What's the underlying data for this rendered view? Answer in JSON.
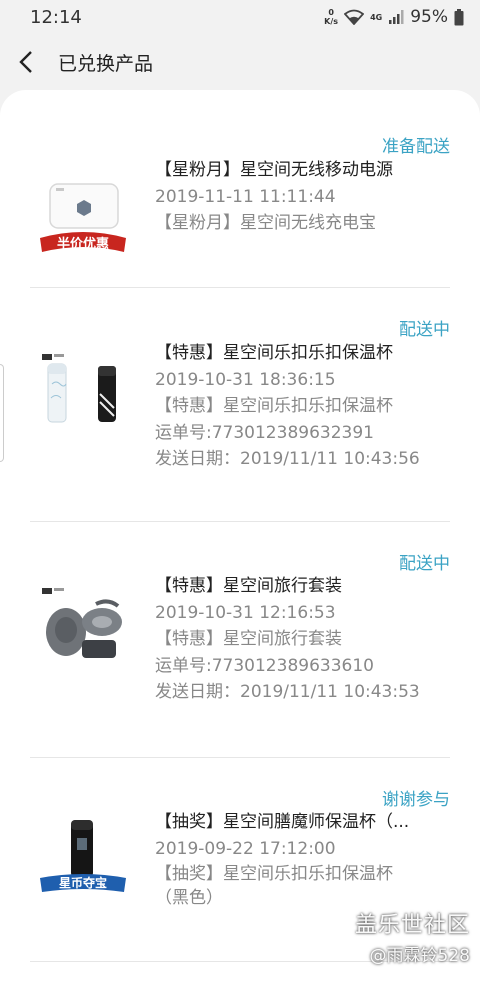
{
  "status_bar": {
    "time": "12:14",
    "net_speed_value": "0",
    "net_speed_unit": "K/s",
    "network": "4G",
    "battery": "95%"
  },
  "header": {
    "title": "已兑换产品"
  },
  "items": [
    {
      "status": "准备配送",
      "name": "【星粉月】星空间无线移动电源",
      "date": "2019-11-11 11:11:44",
      "desc": "【星粉月】星空间无线充电宝",
      "badge": "半价优惠"
    },
    {
      "status": "配送中",
      "name": "【特惠】星空间乐扣乐扣保温杯",
      "date": "2019-10-31 18:36:15",
      "desc": "【特惠】星空间乐扣乐扣保温杯",
      "tracking": "运单号:773012389632391",
      "ship_date": "发送日期：2019/11/11 10:43:56"
    },
    {
      "status": "配送中",
      "name": "【特惠】星空间旅行套装",
      "date": "2019-10-31 12:16:53",
      "desc": "【特惠】星空间旅行套装",
      "tracking": "运单号:773012389633610",
      "ship_date": "发送日期：2019/11/11 10:43:53"
    },
    {
      "status": "谢谢参与",
      "name": "【抽奖】星空间膳魔师保温杯（...",
      "date": "2019-09-22 17:12:00",
      "desc": "【抽奖】星空间乐扣乐扣保温杯（黑色）",
      "badge": "星币夺宝"
    }
  ],
  "watermark": {
    "line1": "盖乐世社区",
    "line2": "@雨霖铃528"
  }
}
